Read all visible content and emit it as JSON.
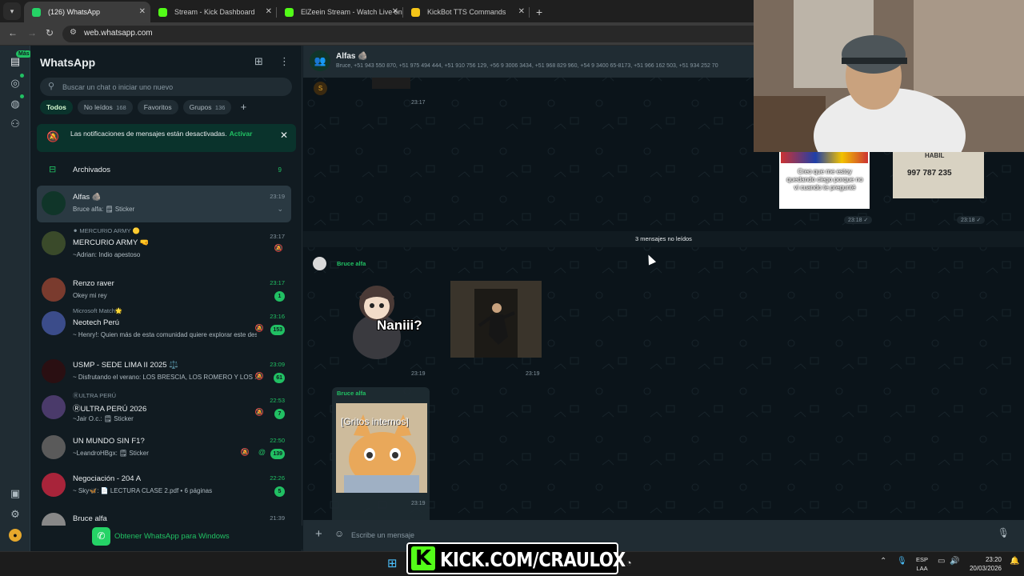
{
  "browser": {
    "tabs": [
      {
        "title": "(126) WhatsApp",
        "favicon_color": "#25d366",
        "active": true
      },
      {
        "title": "Stream - Kick Dashboard",
        "favicon_color": "#53fc18",
        "active": false
      },
      {
        "title": "ElZeein Stream - Watch Live on",
        "favicon_color": "#53fc18",
        "active": false
      },
      {
        "title": "KickBot TTS Commands",
        "favicon_color": "#f5c518",
        "active": false
      }
    ],
    "url": "web.whatsapp.com"
  },
  "rail": {
    "chats_badge": "Más",
    "icons": [
      "chats-icon",
      "status-icon",
      "channels-icon",
      "communities-icon",
      "media-icon",
      "settings-icon",
      "profile-icon"
    ]
  },
  "sidebar": {
    "title": "WhatsApp",
    "search_placeholder": "Buscar un chat o iniciar uno nuevo",
    "filters": [
      {
        "label": "Todos",
        "count": ""
      },
      {
        "label": "No leídos",
        "count": "168"
      },
      {
        "label": "Favoritos",
        "count": ""
      },
      {
        "label": "Grupos",
        "count": "136"
      }
    ],
    "notification": {
      "text": "Las notificaciones de mensajes están desactivadas.",
      "action": "Activar"
    },
    "archived": {
      "label": "Archivados",
      "count": "9"
    },
    "chats": [
      {
        "pre": "",
        "name": "Alfas 🪨",
        "msg": "Bruce alfa: 🗒 Sticker",
        "time": "23:19",
        "badge": "",
        "muted": false,
        "at": false,
        "selected": true
      },
      {
        "pre": "⚫ MERCURIO ARMY 🟡",
        "name": "MERCURIO ARMY 🤜",
        "msg": "~Adrian: Indio apestoso",
        "time": "23:17",
        "badge": "",
        "muted": true,
        "at": false,
        "selected": false
      },
      {
        "pre": "",
        "name": "Renzo raver",
        "msg": "Okey mi rey",
        "time": "23:17",
        "badge": "1",
        "muted": false,
        "at": false,
        "selected": false
      },
      {
        "pre": "Microsoft Match🌟",
        "name": "Neotech Perú",
        "msg": "~ Henry!: Quien más de esta comunidad quiere explorar este desafío?",
        "time": "23:16",
        "badge": "153",
        "muted": true,
        "at": false,
        "selected": false
      },
      {
        "pre": "",
        "name": "USMP - SEDE LIMA II 2025 ⚖️",
        "msg": "~ Disfrutando el verano: LOS BRESCIA, LOS ROMERO Y LOS ...",
        "time": "23:09",
        "badge": "61",
        "muted": true,
        "at": false,
        "selected": false
      },
      {
        "pre": "ⓇULTRA PERÚ",
        "name": "ⓇULTRA PERÚ 2026",
        "msg": "~Jair O.c.: 🗒 Sticker",
        "time": "22:53",
        "badge": "7",
        "muted": true,
        "at": false,
        "selected": false
      },
      {
        "pre": "",
        "name": "UN MUNDO SIN F1?",
        "msg": "~LeandroHBgx: 🗒 Sticker",
        "time": "22:50",
        "badge": "139",
        "muted": true,
        "at": true,
        "selected": false
      },
      {
        "pre": "",
        "name": "Negociación - 204 A",
        "msg": "~ Sky🦋: 📄 LECTURA CLASE 2.pdf • 6 páginas",
        "time": "22:26",
        "badge": "5",
        "muted": false,
        "at": false,
        "selected": false
      },
      {
        "pre": "",
        "name": "Bruce alfa",
        "msg": "",
        "time": "21:39",
        "badge": "",
        "muted": false,
        "at": false,
        "selected": false
      }
    ],
    "get_windows": "Obtener WhatsApp para Windows"
  },
  "conversation": {
    "title": "Alfas 🪨",
    "members": "Bruce, +51 943 550 870, +51 975 494 444, +51 910 756 129, +56 9 3006 3434, +51 968 829 960, +54 9 3400 65-8173, +51 966 162 503, +51 934 252 70",
    "top_sender_initial": "S",
    "top_time": "23:17",
    "right_sticker_text": "Creo que me estoy quedando ciego porque no vi cuando te pregunté",
    "right_sticker_phone": "997 787 235",
    "right_sticker_word": "HABIL",
    "right_time_1": "23:18",
    "right_time_2": "23:18",
    "unread_divider": "3 mensajes no leídos",
    "sender_1": "Bruce alfa",
    "sticker_1_text": "Naniii?",
    "time_1": "23:19",
    "time_2": "23:19",
    "sender_2": "Bruce alfa",
    "sticker_3_text": "[Gritos internos]",
    "time_3": "23:19",
    "composer_placeholder": "Escribe un mensaje"
  },
  "overlay": {
    "kick_text": "KICK.COM/CRAULOX"
  },
  "taskbar": {
    "lang_top": "ESP",
    "lang_bottom": "LAA",
    "time": "23:20",
    "date": "20/03/2026"
  },
  "colors": {
    "accent": "#21c063",
    "kick": "#53fc18",
    "panel": "#111b21",
    "chat_bg": "#0b141a"
  }
}
